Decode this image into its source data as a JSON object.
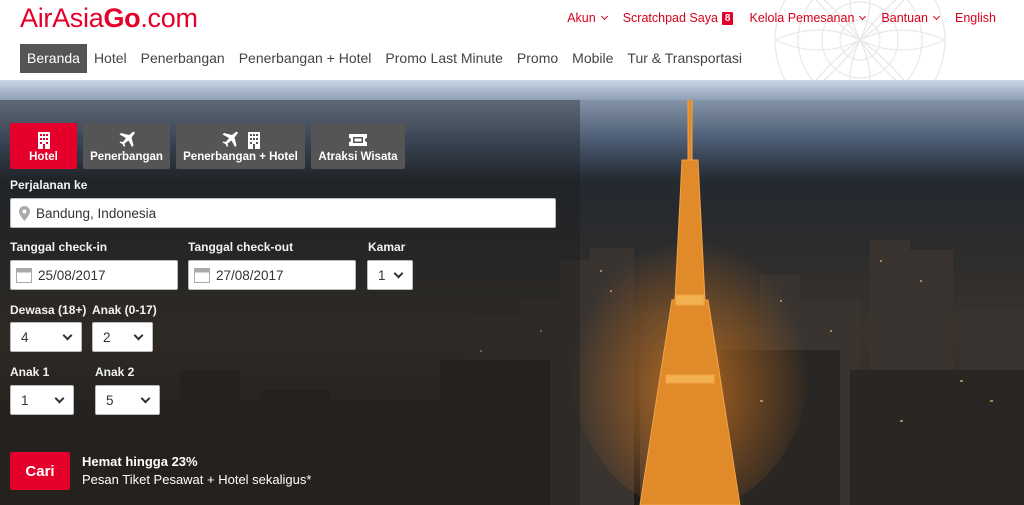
{
  "logo": {
    "part1": "AirAsia",
    "part2": "Go",
    "part3": ".com"
  },
  "toplinks": {
    "akun": "Akun",
    "scratchpad": "Scratchpad Saya",
    "scratchpad_count": "8",
    "kelola": "Kelola Pemesanan",
    "bantuan": "Bantuan",
    "english": "English"
  },
  "nav": {
    "beranda": "Beranda",
    "hotel": "Hotel",
    "penerbangan": "Penerbangan",
    "penerbangan_hotel": "Penerbangan + Hotel",
    "promo_last_minute": "Promo Last Minute",
    "promo": "Promo",
    "mobile": "Mobile",
    "tur": "Tur & Transportasi"
  },
  "tabs": {
    "hotel": "Hotel",
    "penerbangan": "Penerbangan",
    "penerbangan_hotel": "Penerbangan + Hotel",
    "atraksi": "Atraksi Wisata"
  },
  "form": {
    "destination_label": "Perjalanan ke",
    "destination_value": "Bandung, Indonesia",
    "checkin_label": "Tanggal check-in",
    "checkin_value": "25/08/2017",
    "checkout_label": "Tanggal check-out",
    "checkout_value": "27/08/2017",
    "rooms_label": "Kamar",
    "rooms_value": "1",
    "adults_label": "Dewasa (18+)",
    "adults_value": "4",
    "children_label": "Anak (0-17)",
    "children_value": "2",
    "child1_label": "Anak 1",
    "child1_value": "1",
    "child2_label": "Anak 2",
    "child2_value": "5"
  },
  "search": {
    "button": "Cari",
    "promo_title": "Hemat hingga 23%",
    "promo_text": "Pesan Tiket Pesawat + Hotel sekaligus*"
  },
  "colors": {
    "brand_red": "#e4002b",
    "nav_active": "#555555",
    "tab_inactive": "#555555"
  }
}
